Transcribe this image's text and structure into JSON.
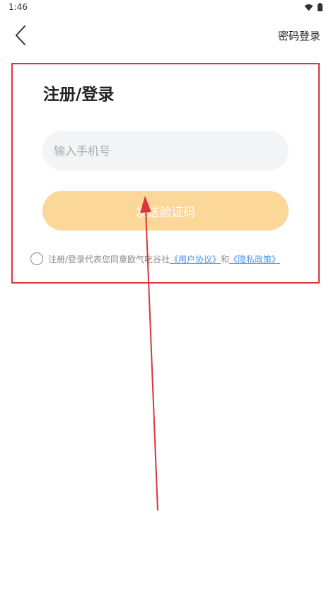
{
  "status_bar": {
    "time": "1:46",
    "icons": [
      "wifi-icon",
      "battery-icon"
    ]
  },
  "topbar": {
    "back_icon": "chevron-left-icon",
    "password_login_label": "密码登录"
  },
  "form": {
    "title": "注册/登录",
    "phone_placeholder": "输入手机号",
    "phone_value": "",
    "send_code_label": "发送验证码"
  },
  "agreement": {
    "prefix": "注册/登录代表您同意欧气吃谷社",
    "user_agreement_link": "《用户协议》",
    "conjunction": "和",
    "privacy_policy_link": "《隐私政策》"
  },
  "colors": {
    "annotation_red": "#d9363e",
    "button_orange_disabled": "#fbd799",
    "link_blue": "#4a8ee8",
    "input_bg": "#f3f4f6"
  }
}
